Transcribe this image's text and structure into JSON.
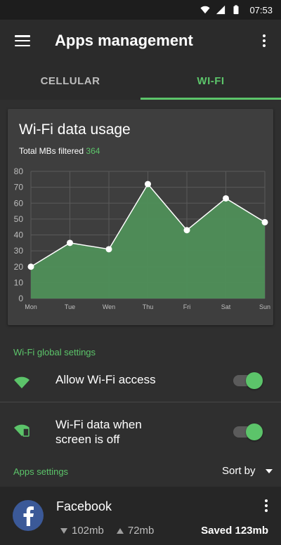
{
  "status_bar": {
    "time": "07:53"
  },
  "app_bar": {
    "title": "Apps management"
  },
  "tabs": [
    {
      "label": "CELLULAR",
      "active": false
    },
    {
      "label": "WI-FI",
      "active": true
    }
  ],
  "card": {
    "title": "Wi-Fi data usage",
    "subtitle_prefix": "Total MBs filtered",
    "subtitle_value": "364"
  },
  "chart_data": {
    "type": "area",
    "categories": [
      "Mon",
      "Tue",
      "Wen",
      "Thu",
      "Fri",
      "Sat",
      "Sun"
    ],
    "values": [
      20,
      35,
      31,
      72,
      43,
      63,
      48
    ],
    "ylim": [
      0,
      80
    ],
    "yticks": [
      0,
      10,
      20,
      30,
      40,
      50,
      60,
      70,
      80
    ],
    "grid": true,
    "fill_color": "#4f8f58",
    "line_color": "#ffffff"
  },
  "wifi_settings": {
    "section_label": "Wi-Fi global settings",
    "allow_access_label": "Allow Wi-Fi access",
    "allow_access_on": true,
    "screen_off_label_line1": "Wi-Fi data when",
    "screen_off_label_line2": "screen is off",
    "screen_off_on": true
  },
  "apps_settings": {
    "section_label": "Apps settings",
    "sort_label": "Sort by"
  },
  "apps": [
    {
      "name": "Facebook",
      "down": "102mb",
      "up": "72mb",
      "saved": "Saved 123mb"
    }
  ],
  "colors": {
    "accent": "#5cc46a",
    "background": "#2f2f2f",
    "card": "#3e3e3e"
  }
}
